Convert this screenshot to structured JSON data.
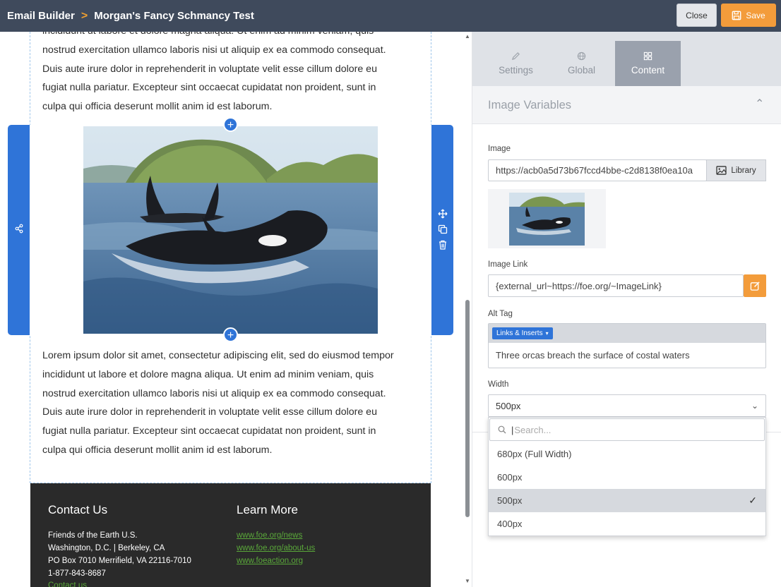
{
  "header": {
    "breadcrumb_root": "Email Builder",
    "separator": ">",
    "title": "Morgan's Fancy Schmancy Test",
    "close_label": "Close",
    "save_label": "Save"
  },
  "canvas": {
    "paragraph_top_lines": [
      "incididunt ut labore et dolore magna aliqua. Ut enim ad minim veniam, quis",
      "nostrud exercitation ullamco laboris nisi ut aliquip ex ea commodo consequat.",
      "Duis aute irure dolor in reprehenderit in voluptate velit esse cillum dolore eu",
      "fugiat nulla pariatur. Excepteur sint occaecat cupidatat non proident, sunt in",
      "culpa qui officia deserunt mollit anim id est laborum."
    ],
    "paragraph_bottom_lines": [
      "Lorem ipsum dolor sit amet, consectetur adipiscing elit, sed do eiusmod tempor",
      "incididunt ut labore et dolore magna aliqua. Ut enim ad minim veniam, quis",
      "nostrud exercitation ullamco laboris nisi ut aliquip ex ea commodo consequat.",
      "Duis aute irure dolor in reprehenderit in voluptate velit esse cillum dolore eu",
      "fugiat nulla pariatur. Excepteur sint occaecat cupidatat non proident, sunt in",
      "culpa qui officia deserunt mollit anim id est laborum."
    ],
    "footer": {
      "contact_heading": "Contact Us",
      "contact_lines": [
        "Friends of the Earth U.S.",
        "Washington, D.C. | Berkeley, CA",
        "PO Box 7010 Merrifield, VA 22116-7010",
        "1-877-843-8687"
      ],
      "contact_link": "Contact us",
      "learn_heading": "Learn More",
      "learn_links": [
        "www.foe.org/news",
        "www.foe.org/about-us",
        "www.foeaction.org"
      ]
    }
  },
  "panel": {
    "tabs": [
      {
        "label": "Settings",
        "icon": "pencil-icon"
      },
      {
        "label": "Global",
        "icon": "globe-icon"
      },
      {
        "label": "Content",
        "icon": "grid-icon",
        "active": true
      }
    ],
    "section_title": "Image Variables",
    "image": {
      "label": "Image",
      "value": "https://acb0a5d73b67fccd4bbe-c2d8138f0ea10a",
      "library_label": "Library"
    },
    "image_link": {
      "label": "Image Link",
      "value": "{external_url~https://foe.org/~ImageLink}"
    },
    "alt_tag": {
      "label": "Alt Tag",
      "chip_label": "Links & Inserts",
      "value": "Three orcas breach the surface of costal waters"
    },
    "width": {
      "label": "Width",
      "selected": "500px",
      "search_placeholder": "Search...",
      "options": [
        "680px (Full Width)",
        "600px",
        "500px",
        "400px"
      ],
      "selected_index": 2
    }
  },
  "colors": {
    "topbar": "#3f4a5c",
    "accent_orange": "#f39c3b",
    "selection_blue": "#2f74d8",
    "footer_bg": "#2a2a2a",
    "footer_link": "#5aa83a"
  }
}
